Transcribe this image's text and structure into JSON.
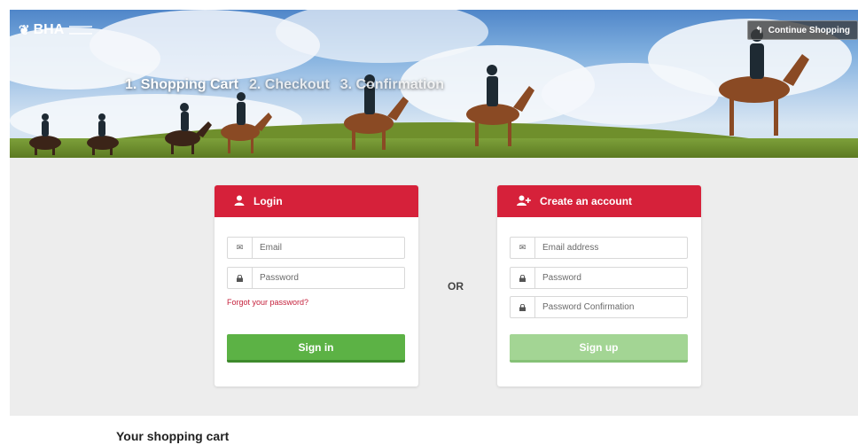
{
  "header": {
    "logo_text": "BHA",
    "steps": [
      "1. Shopping Cart",
      "2. Checkout",
      "3. Confirmation"
    ],
    "continue_label": "Continue Shopping"
  },
  "login": {
    "title": "Login",
    "email_placeholder": "Email",
    "password_placeholder": "Password",
    "forgot_label": "Forgot your password?",
    "submit_label": "Sign in"
  },
  "separator": "OR",
  "register": {
    "title": "Create an account",
    "email_placeholder": "Email address",
    "password_placeholder": "Password",
    "confirm_placeholder": "Password Confirmation",
    "submit_label": "Sign up"
  },
  "cart": {
    "title": "Your shopping cart"
  },
  "colors": {
    "accent_red": "#d6213a",
    "signin_green": "#5cb245",
    "signup_green_disabled": "#a3d594",
    "panel_grey": "#ededed"
  },
  "icons": {
    "login": "user-icon",
    "register": "user-plus-icon",
    "email": "envelope-icon",
    "password": "lock-icon",
    "continue": "reply-arrow-icon"
  }
}
